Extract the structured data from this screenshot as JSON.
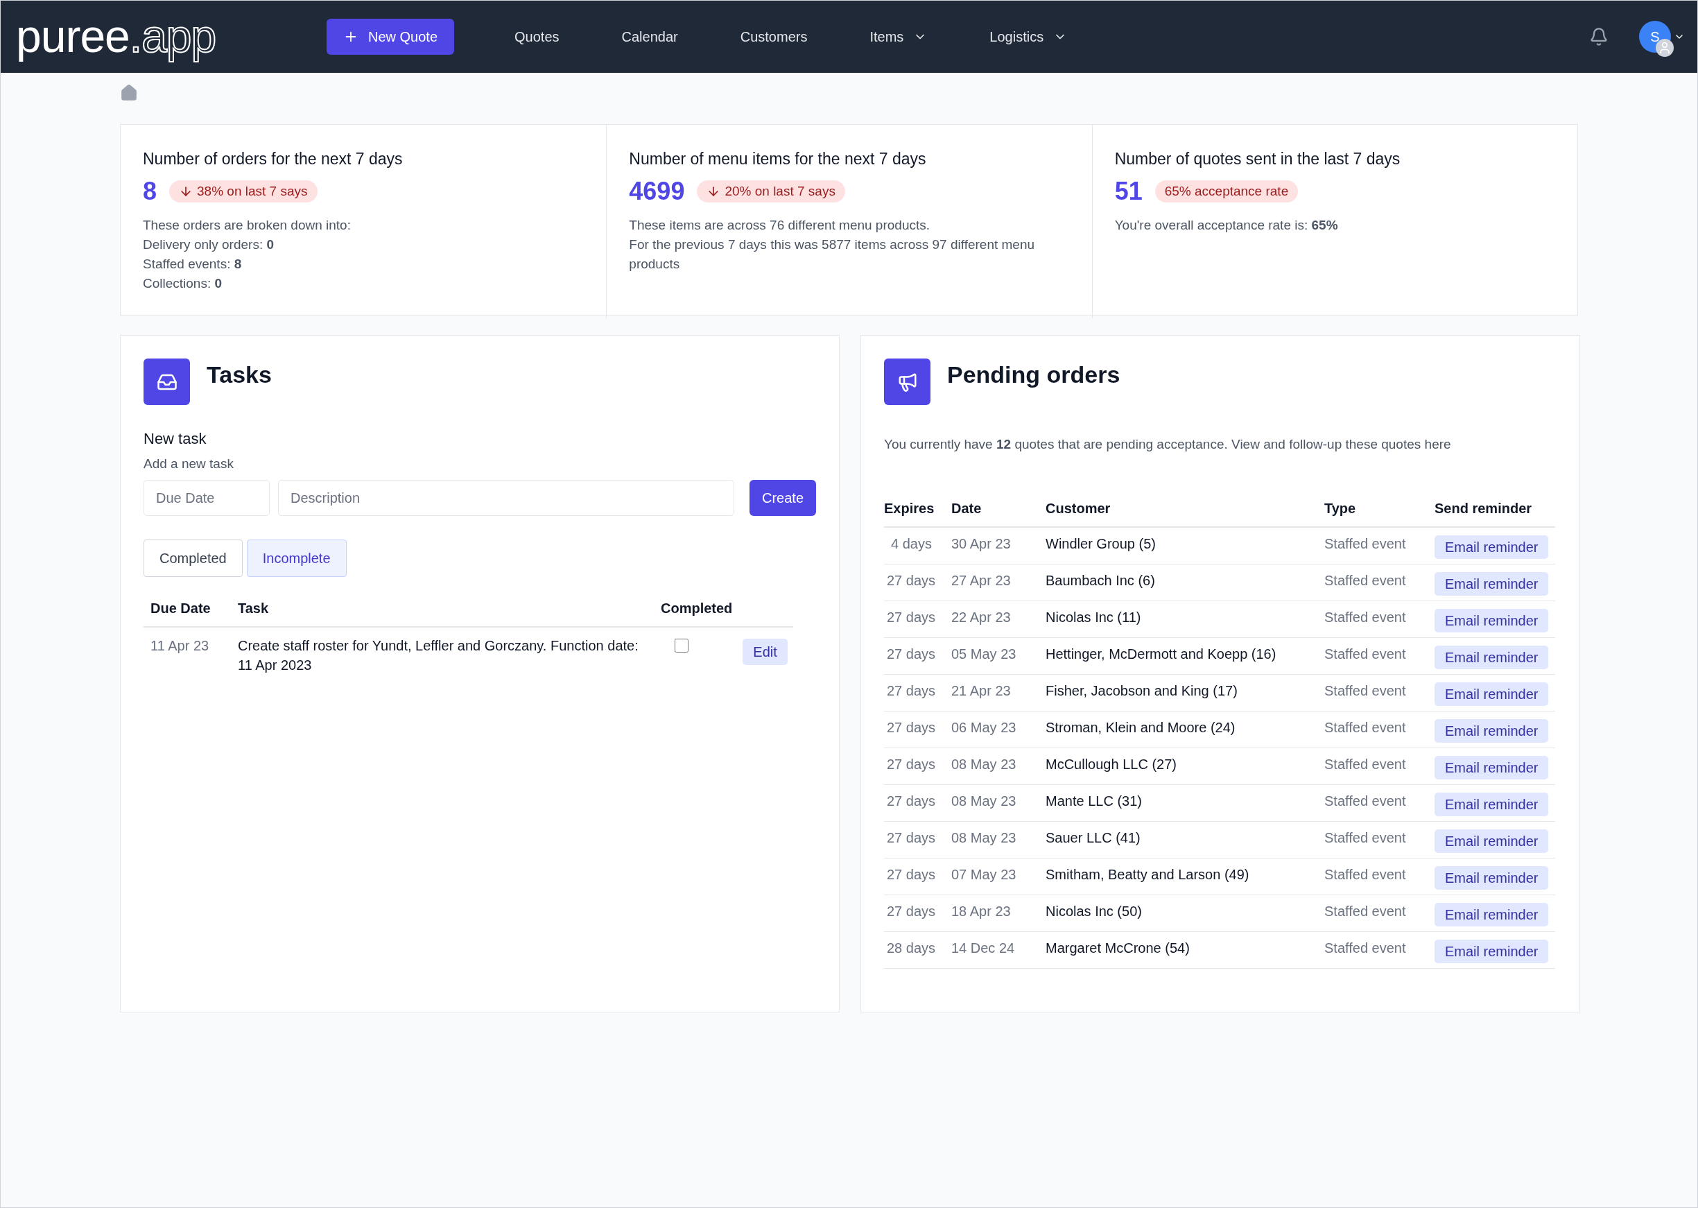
{
  "navbar": {
    "logo": {
      "main": "puree",
      "suffix": ".app"
    },
    "new_quote": "New Quote",
    "links": [
      {
        "label": "Quotes",
        "dropdown": false
      },
      {
        "label": "Calendar",
        "dropdown": false
      },
      {
        "label": "Customers",
        "dropdown": false
      },
      {
        "label": "Items",
        "dropdown": true
      },
      {
        "label": "Logistics",
        "dropdown": true
      }
    ],
    "avatar": "S"
  },
  "stats": [
    {
      "title": "Number of orders for the next 7 days",
      "value": "8",
      "badge": {
        "kind": "down",
        "text": "38% on last 7 says"
      },
      "lines": [
        "These orders are broken down into:",
        "Delivery only orders: **0**",
        "Staffed events: **8**",
        "Collections: **0**"
      ]
    },
    {
      "title": "Number of menu items for the next 7 days",
      "value": "4699",
      "badge": {
        "kind": "down",
        "text": "20% on last 7 says"
      },
      "lines": [
        "These items are across 76 different menu products.",
        "For the previous 7 days this was 5877 items across 97 different menu products"
      ]
    },
    {
      "title": "Number of quotes sent in the last 7 days",
      "value": "51",
      "badge": {
        "kind": "plain",
        "text": "65% acceptance rate"
      },
      "lines": [
        "You're overall acceptance rate is: **65%**"
      ]
    }
  ],
  "tasks": {
    "title": "Tasks",
    "new_task_heading": "New task",
    "new_task_hint": "Add a new task",
    "due_placeholder": "Due Date",
    "description_placeholder": "Description",
    "create": "Create",
    "filters": [
      {
        "label": "Completed",
        "selected": false
      },
      {
        "label": "Incomplete",
        "selected": true
      }
    ],
    "columns": [
      "Due Date",
      "Task",
      "Completed"
    ],
    "rows": [
      {
        "due": "11 Apr 23",
        "task": "Create staff roster for Yundt, Leffler and Gorczany. Function date: 11 Apr 2023",
        "completed": false,
        "action": "Edit"
      }
    ]
  },
  "pending": {
    "title": "Pending orders",
    "summary": "You currently have **12** quotes that are pending acceptance. View and follow-up these quotes here",
    "columns": [
      "Expires",
      "Date",
      "Customer",
      "Type",
      "Send reminder"
    ],
    "rows": [
      {
        "expires": "4 days",
        "date": "30 Apr 23",
        "customer": "Windler Group (5)",
        "type": "Staffed event",
        "action": "Email reminder"
      },
      {
        "expires": "27 days",
        "date": "27 Apr 23",
        "customer": "Baumbach Inc (6)",
        "type": "Staffed event",
        "action": "Email reminder"
      },
      {
        "expires": "27 days",
        "date": "22 Apr 23",
        "customer": "Nicolas Inc (11)",
        "type": "Staffed event",
        "action": "Email reminder"
      },
      {
        "expires": "27 days",
        "date": "05 May 23",
        "customer": "Hettinger, McDermott and Koepp (16)",
        "type": "Staffed event",
        "action": "Email reminder"
      },
      {
        "expires": "27 days",
        "date": "21 Apr 23",
        "customer": "Fisher, Jacobson and King (17)",
        "type": "Staffed event",
        "action": "Email reminder"
      },
      {
        "expires": "27 days",
        "date": "06 May 23",
        "customer": "Stroman, Klein and Moore (24)",
        "type": "Staffed event",
        "action": "Email reminder"
      },
      {
        "expires": "27 days",
        "date": "08 May 23",
        "customer": "McCullough LLC (27)",
        "type": "Staffed event",
        "action": "Email reminder"
      },
      {
        "expires": "27 days",
        "date": "08 May 23",
        "customer": "Mante LLC (31)",
        "type": "Staffed event",
        "action": "Email reminder"
      },
      {
        "expires": "27 days",
        "date": "08 May 23",
        "customer": "Sauer LLC (41)",
        "type": "Staffed event",
        "action": "Email reminder"
      },
      {
        "expires": "27 days",
        "date": "07 May 23",
        "customer": "Smitham, Beatty and Larson (49)",
        "type": "Staffed event",
        "action": "Email reminder"
      },
      {
        "expires": "27 days",
        "date": "18 Apr 23",
        "customer": "Nicolas Inc (50)",
        "type": "Staffed event",
        "action": "Email reminder"
      },
      {
        "expires": "28 days",
        "date": "14 Dec 24",
        "customer": "Margaret McCrone (54)",
        "type": "Staffed event",
        "action": "Email reminder"
      }
    ]
  }
}
